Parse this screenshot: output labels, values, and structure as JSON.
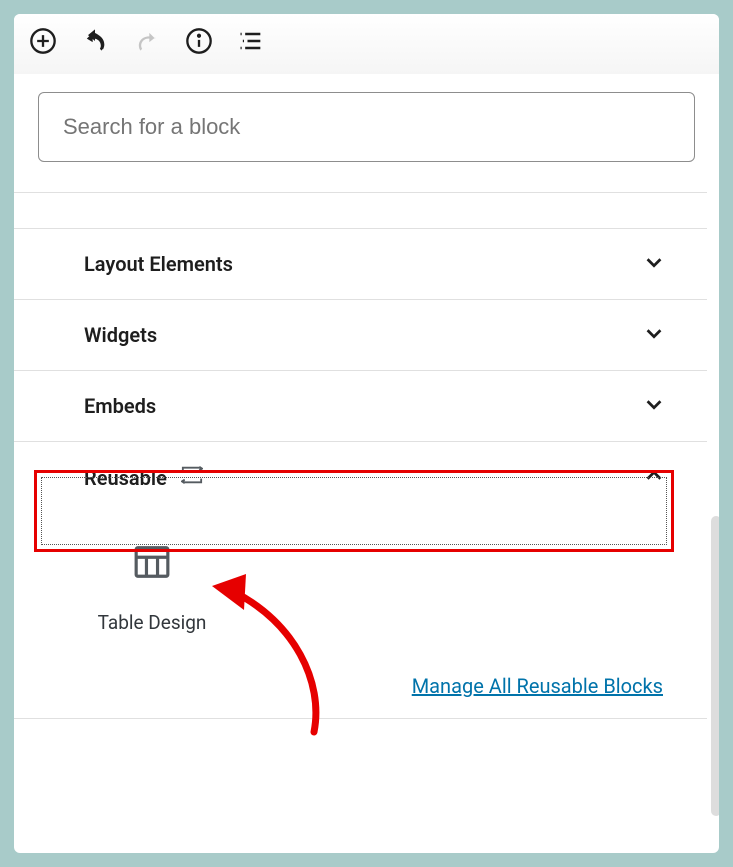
{
  "toolbar": {
    "add_label": "add-block",
    "undo_label": "undo",
    "redo_label": "redo",
    "info_label": "info",
    "outline_label": "outline"
  },
  "search": {
    "placeholder": "Search for a block"
  },
  "categories": [
    {
      "label": "Layout Elements",
      "expanded": false
    },
    {
      "label": "Widgets",
      "expanded": false
    },
    {
      "label": "Embeds",
      "expanded": false
    },
    {
      "label": "Reusable",
      "expanded": true
    }
  ],
  "reusable_blocks": [
    {
      "label": "Table Design",
      "icon": "table-icon"
    }
  ],
  "manage_link": "Manage All Reusable Blocks"
}
